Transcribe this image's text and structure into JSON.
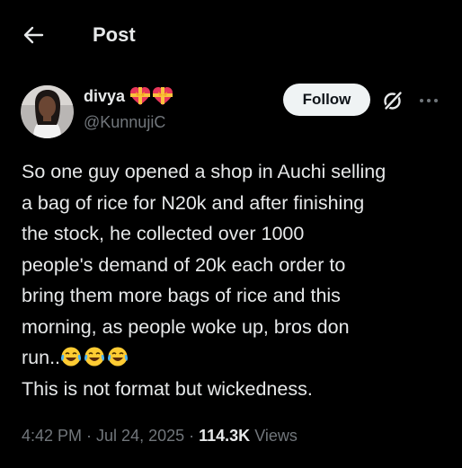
{
  "header": {
    "title": "Post"
  },
  "author": {
    "display_name": "divya",
    "handle": "@KunnujiC",
    "name_emojis": [
      "heart-with-ribbon-emoji",
      "heart-with-ribbon-emoji"
    ]
  },
  "actions": {
    "follow_label": "Follow"
  },
  "tweet": {
    "lines": [
      "So one guy opened a shop in Auchi selling",
      "a bag of rice for N20k and after finishing",
      "the stock, he collected over 1000",
      "people's demand of 20k each order to",
      "bring them more bags of rice and this",
      "morning, as people woke up, bros don",
      "run..",
      "This is not format but wickedness."
    ],
    "line7_emojis": [
      "face-with-tears-of-joy-emoji",
      "face-with-tears-of-joy-emoji",
      "face-with-tears-of-joy-emoji"
    ]
  },
  "meta": {
    "time": "4:42 PM",
    "separator": " · ",
    "date": "Jul 24, 2025",
    "views_count": "114.3K",
    "views_label": " Views"
  },
  "colors": {
    "background": "#000000",
    "text_primary": "#e7e9ea",
    "text_secondary": "#71767b",
    "follow_button_bg": "#eff3f4",
    "follow_button_text": "#0f1419"
  }
}
